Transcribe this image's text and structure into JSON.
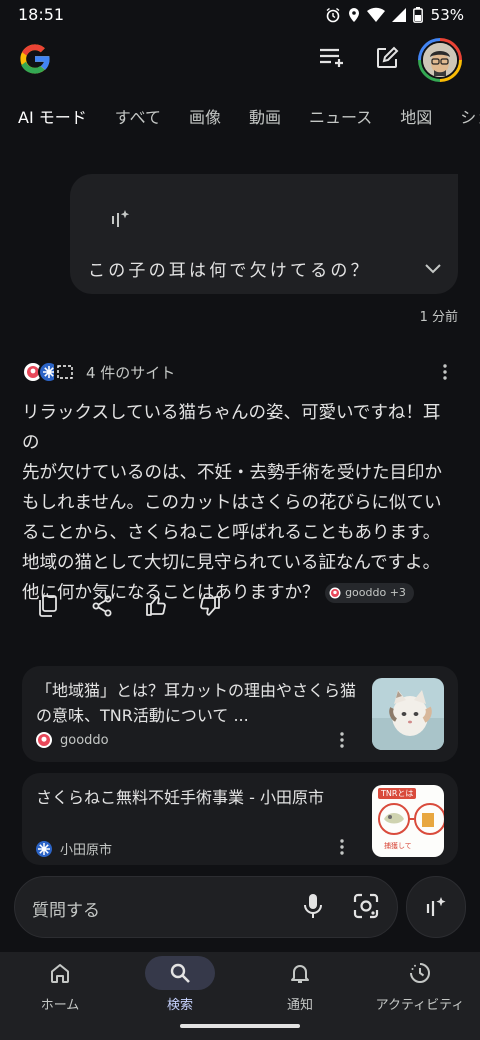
{
  "status_bar": {
    "time": "18:51",
    "battery": "53%"
  },
  "header": {
    "icons": [
      "google-logo",
      "tasks-icon",
      "edit-icon",
      "avatar"
    ]
  },
  "tabs": [
    "AI モード",
    "すべて",
    "画像",
    "動画",
    "ニュース",
    "地図",
    "ショ"
  ],
  "conversation": {
    "question": "この子の耳は何で欠けてるの？",
    "time_ago": "1 分前",
    "sources_label": "4 件のサイト",
    "answer_lines": [
      "リラックスしている猫ちゃんの姿、可愛いですね！耳の",
      "先が欠けているのは、不妊・去勢手術を受けた目印か",
      "もしれません。このカットはさくらの花びらに似てい",
      "ることから、さくらねこと呼ばれることもあります。",
      "地域の猫として大切に見守られている証なんですよ。",
      "他に何か気になることはありますか？"
    ],
    "citation_chip": "gooddo +3"
  },
  "results": [
    {
      "title": "「地域猫」とは？耳カットの理由やさくら猫の意味、TNR活動について ...",
      "source": "gooddo"
    },
    {
      "title": "さくらねこ無料不妊手術事業 - 小田原市",
      "source": "小田原市",
      "thumb_text": "TNRとは",
      "thumb_caption": "捕獲して"
    }
  ],
  "input": {
    "placeholder": "質問する"
  },
  "bottom_nav": [
    {
      "label": "ホーム",
      "icon": "home-icon"
    },
    {
      "label": "検索",
      "icon": "search-icon",
      "active": true
    },
    {
      "label": "通知",
      "icon": "bell-icon"
    },
    {
      "label": "アクティビティ",
      "icon": "activity-icon"
    }
  ],
  "colors": {
    "background": "#101114",
    "surface": "#1f2023",
    "nav_active": "#36394a"
  }
}
